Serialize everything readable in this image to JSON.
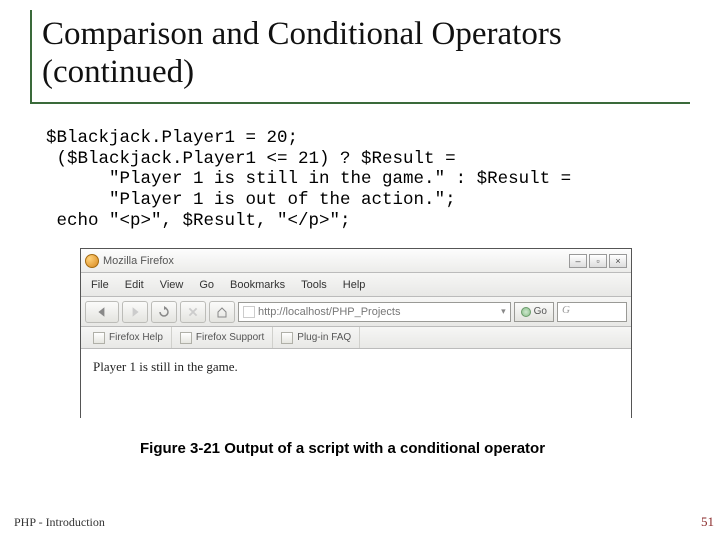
{
  "title_line1": "Comparison and Conditional Operators",
  "title_line2": "(continued)",
  "code": "$Blackjack.Player1 = 20;\n ($Blackjack.Player1 <= 21) ? $Result =\n      \"Player 1 is still in the game.\" : $Result =\n      \"Player 1 is out of the action.\";\n echo \"<p>\", $Result, \"</p>\";",
  "browser": {
    "title": "Mozilla Firefox",
    "menu": [
      "File",
      "Edit",
      "View",
      "Go",
      "Bookmarks",
      "Tools",
      "Help"
    ],
    "address": "http://localhost/PHP_Projects",
    "go_label": "Go",
    "search_placeholder": "G",
    "bookmarks": [
      "Firefox Help",
      "Firefox Support",
      "Plug-in FAQ"
    ],
    "page_text": "Player 1 is still in the game."
  },
  "caption": "Figure 3-21  Output of a script with a conditional operator",
  "footer_left": "PHP - Introduction",
  "footer_right": "51"
}
